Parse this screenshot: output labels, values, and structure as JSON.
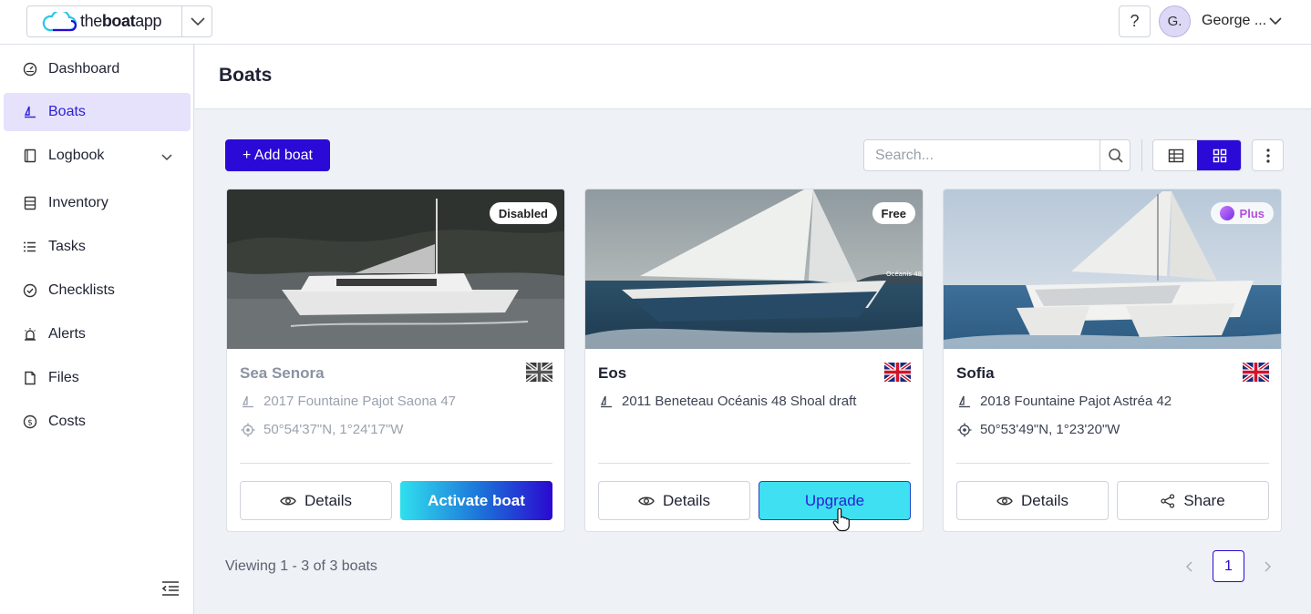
{
  "app": {
    "logo_prefix": "the",
    "logo_bold": "boat",
    "logo_suffix": "app",
    "brand_color": "#2b09d6"
  },
  "header": {
    "help_label": "?",
    "avatar_initials": "G.",
    "user_name": "George ..."
  },
  "sidebar": {
    "items": [
      {
        "label": "Dashboard",
        "icon": "dashboard-icon"
      },
      {
        "label": "Boats",
        "icon": "boat-icon",
        "active": true
      },
      {
        "label": "Logbook",
        "icon": "book-icon",
        "expandable": true
      },
      {
        "label": "Inventory",
        "icon": "inventory-icon"
      },
      {
        "label": "Tasks",
        "icon": "tasks-icon"
      },
      {
        "label": "Checklists",
        "icon": "checklist-icon"
      },
      {
        "label": "Alerts",
        "icon": "alarm-icon"
      },
      {
        "label": "Files",
        "icon": "file-icon"
      },
      {
        "label": "Costs",
        "icon": "dollar-icon"
      }
    ]
  },
  "page": {
    "title": "Boats",
    "add_button": "+ Add boat",
    "search_placeholder": "Search...",
    "view_mode": "grid"
  },
  "boats": [
    {
      "name": "Sea Senora",
      "badge": "Disabled",
      "flag": "uk-flag-grey",
      "model": "2017 Fountaine Pajot Saona 47",
      "position": "50°54'37\"N, 1°24'17\"W",
      "details_label": "Details",
      "action_label": "Activate boat"
    },
    {
      "name": "Eos",
      "badge": "Free",
      "flag": "uk-flag",
      "model": "2011 Beneteau Océanis 48 Shoal draft",
      "position": "",
      "details_label": "Details",
      "action_label": "Upgrade"
    },
    {
      "name": "Sofia",
      "badge": "Plus",
      "flag": "uk-flag",
      "model": "2018 Fountaine Pajot Astréa 42",
      "position": "50°53'49\"N, 1°23'20\"W",
      "details_label": "Details",
      "action_label": "Share"
    }
  ],
  "footer": {
    "viewing_text": "Viewing 1 - 3 of 3 boats",
    "current_page": "1"
  }
}
